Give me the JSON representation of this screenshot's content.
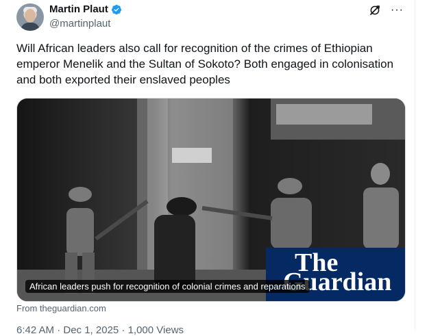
{
  "author": {
    "name": "Martin Plaut",
    "handle": "@martinplaut",
    "avatar_icon": "profile-photo",
    "verified_color": "#1d9bf0"
  },
  "tweet": {
    "text": "Will African leaders also call for recognition of the crimes of Ethiopian emperor Menelik and the Sultan of Sokoto? Both engaged in colonisation and both exported their enslaved peoples"
  },
  "card": {
    "caption": "African leaders push for recognition of colonial crimes and reparations",
    "publisher_the": "The",
    "publisher_name": "Guardian",
    "publisher_color": "#052962",
    "source": "From theguardian.com"
  },
  "actions": {
    "grok_icon": "grok-icon",
    "more_icon": "more-icon",
    "more_label": "···"
  },
  "meta": {
    "timestamp": "6:42 AM · Dec 1, 2025 · 1,000 Views"
  }
}
